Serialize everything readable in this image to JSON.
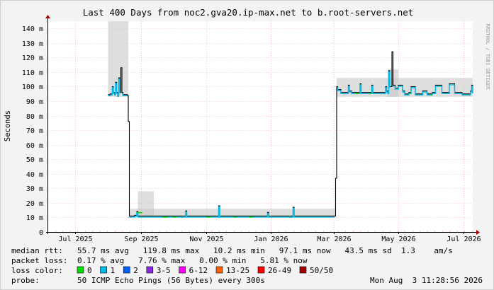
{
  "chart_data": {
    "type": "line",
    "title": "Last 400 Days from noc2.gva20.ip-max.net to b.root-servers.net",
    "ylabel": "Seconds",
    "side_label": "RRDTOOL / TOBI OETIKER",
    "ylim": [
      0,
      145
    ],
    "y_unit": "m",
    "y_ticks": [
      {
        "value": 0,
        "label": "0"
      },
      {
        "value": 10,
        "label": "10 m"
      },
      {
        "value": 20,
        "label": "20 m"
      },
      {
        "value": 30,
        "label": "30 m"
      },
      {
        "value": 40,
        "label": "40 m"
      },
      {
        "value": 50,
        "label": "50 m"
      },
      {
        "value": 60,
        "label": "60 m"
      },
      {
        "value": 70,
        "label": "70 m"
      },
      {
        "value": 80,
        "label": "80 m"
      },
      {
        "value": 90,
        "label": "90 m"
      },
      {
        "value": 100,
        "label": "100 m"
      },
      {
        "value": 110,
        "label": "110 m"
      },
      {
        "value": 120,
        "label": "120 m"
      },
      {
        "value": 130,
        "label": "130 m"
      },
      {
        "value": 140,
        "label": "140 m"
      }
    ],
    "x_ticks": [
      {
        "label": "Jul 2025",
        "day": 26
      },
      {
        "label": "Sep 2025",
        "day": 88
      },
      {
        "label": "Nov 2025",
        "day": 149
      },
      {
        "label": "Jan 2026",
        "day": 210
      },
      {
        "label": "Mar 2026",
        "day": 269
      },
      {
        "label": "May 2026",
        "day": 330
      },
      {
        "label": "Jul 2026",
        "day": 391
      }
    ],
    "x_range_days": [
      0,
      400
    ],
    "grid": true,
    "series": [
      {
        "points": [
          [
            57,
            94.5
          ],
          [
            59,
            95
          ],
          [
            61,
            100
          ],
          [
            62,
            96
          ],
          [
            63,
            95
          ],
          [
            64,
            103
          ],
          [
            65,
            96
          ],
          [
            66,
            94
          ],
          [
            67,
            106
          ],
          [
            68,
            96
          ],
          [
            69,
            113
          ],
          [
            70,
            96
          ],
          [
            71,
            94.5
          ],
          [
            74,
            94.5
          ],
          [
            75,
            94
          ],
          [
            76,
            76
          ],
          [
            77,
            11
          ],
          [
            80,
            11
          ],
          [
            82,
            11.5
          ],
          [
            84,
            14
          ],
          [
            85,
            11
          ],
          [
            100,
            11
          ],
          [
            110,
            11
          ],
          [
            120,
            11
          ],
          [
            129,
            11
          ],
          [
            130,
            14.5
          ],
          [
            131,
            11
          ],
          [
            150,
            11
          ],
          [
            160,
            11
          ],
          [
            161,
            18
          ],
          [
            162,
            11
          ],
          [
            180,
            11
          ],
          [
            200,
            11
          ],
          [
            206,
            11
          ],
          [
            207,
            13.5
          ],
          [
            208,
            11
          ],
          [
            220,
            11
          ],
          [
            230,
            11
          ],
          [
            231,
            17
          ],
          [
            232,
            11
          ],
          [
            250,
            11
          ],
          [
            270,
            11
          ],
          [
            271,
            37
          ],
          [
            272,
            100
          ],
          [
            273,
            98
          ],
          [
            276,
            96
          ],
          [
            280,
            96
          ],
          [
            283,
            101
          ],
          [
            284,
            97
          ],
          [
            286,
            96
          ],
          [
            292,
            96
          ],
          [
            294,
            102
          ],
          [
            295,
            96
          ],
          [
            303,
            96
          ],
          [
            305,
            101
          ],
          [
            306,
            96
          ],
          [
            316,
            96
          ],
          [
            318,
            100
          ],
          [
            319,
            97
          ],
          [
            320,
            96
          ],
          [
            321,
            111
          ],
          [
            322,
            100
          ],
          [
            324,
            124
          ],
          [
            325,
            101
          ],
          [
            327,
            99
          ],
          [
            330,
            101
          ],
          [
            333,
            101
          ],
          [
            334,
            97
          ],
          [
            336,
            95
          ],
          [
            340,
            96
          ],
          [
            342,
            100
          ],
          [
            345,
            100
          ],
          [
            346,
            95
          ],
          [
            350,
            95
          ],
          [
            353,
            97
          ],
          [
            356,
            97
          ],
          [
            357,
            95
          ],
          [
            362,
            96
          ],
          [
            365,
            101
          ],
          [
            370,
            101
          ],
          [
            371,
            96
          ],
          [
            375,
            96
          ],
          [
            378,
            102
          ],
          [
            382,
            102
          ],
          [
            383,
            96
          ],
          [
            390,
            95
          ],
          [
            395,
            95
          ],
          [
            398,
            97
          ],
          [
            399,
            101
          ],
          [
            400,
            96
          ]
        ],
        "loss_color_ranges": [
          {
            "from": 84,
            "to": 89,
            "color": "#00e000"
          },
          {
            "from": 108,
            "to": 113,
            "color": "#00e000"
          },
          {
            "from": 118,
            "to": 121,
            "color": "#00e000"
          },
          {
            "from": 150,
            "to": 153,
            "color": "#00e000"
          },
          {
            "from": 175,
            "to": 178,
            "color": "#00e000"
          },
          {
            "from": 190,
            "to": 193,
            "color": "#00e000"
          },
          {
            "from": 290,
            "to": 293,
            "color": "#00e000"
          },
          {
            "from": 303,
            "to": 305,
            "color": "#00e000"
          },
          {
            "from": 340,
            "to": 342,
            "color": "#00e000"
          },
          {
            "from": 360,
            "to": 362,
            "color": "#00e000"
          }
        ]
      }
    ],
    "smoke_bands": [
      {
        "from": 57,
        "to": 76,
        "lo": 93,
        "hi": 145
      },
      {
        "from": 77,
        "to": 271,
        "lo": 10.5,
        "hi": 16
      },
      {
        "from": 85,
        "to": 100,
        "lo": 10.5,
        "hi": 28
      },
      {
        "from": 272,
        "to": 400,
        "lo": 93,
        "hi": 106
      },
      {
        "from": 320,
        "to": 330,
        "lo": 93,
        "hi": 112
      }
    ],
    "series_color": "#000000",
    "smoke_color": "#c8c8c8",
    "default_loss_color": "#00b8e8"
  },
  "stats": {
    "median_rtt": {
      "label": "median rtt:",
      "text": "55.7 ms avg   119.8 ms max   10.2 ms min   97.1 ms now   43.5 ms sd  1.3    am/s"
    },
    "packet_loss": {
      "label": "packet loss:",
      "text": "0.17 % avg   7.76 % max   0.00 % min   5.81 % now"
    },
    "probe": {
      "label": "probe:",
      "text": "50 ICMP Echo Pings (56 Bytes) every 300s"
    },
    "timestamp": "Mon Aug  3 11:28:56 2026"
  },
  "loss_legend": {
    "label": "loss color:",
    "items": [
      {
        "label": "0",
        "color": "#00e000"
      },
      {
        "label": "1",
        "color": "#00b8e8"
      },
      {
        "label": "2",
        "color": "#0060ff"
      },
      {
        "label": "3-5",
        "color": "#8a2be2"
      },
      {
        "label": "6-12",
        "color": "#ff00ff"
      },
      {
        "label": "13-25",
        "color": "#ff6000"
      },
      {
        "label": "26-49",
        "color": "#ff0000"
      },
      {
        "label": "50/50",
        "color": "#a00000"
      }
    ]
  }
}
